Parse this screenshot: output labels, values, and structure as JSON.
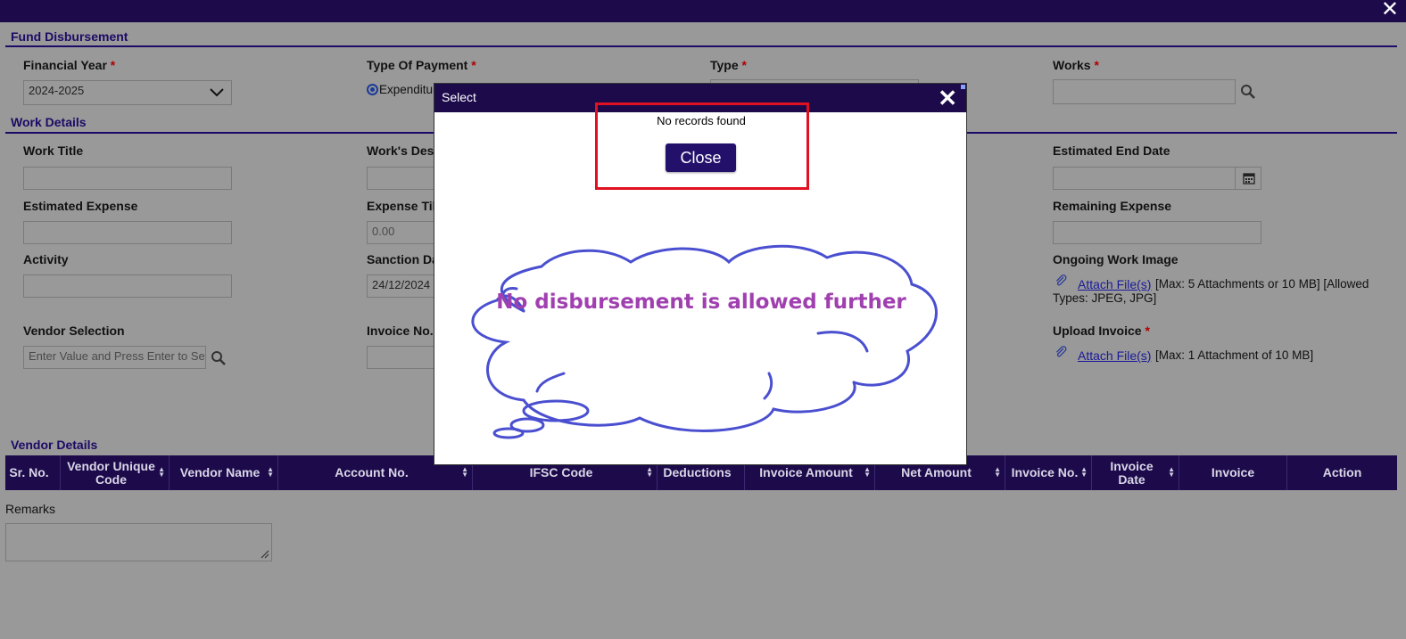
{
  "window": {
    "close_glyph": "✕"
  },
  "sections": {
    "fund_disbursement": "Fund Disbursement",
    "work_details": "Work Details",
    "vendor_details": "Vendor Details"
  },
  "form": {
    "financial_year": {
      "label": "Financial Year",
      "value": "2024-2025"
    },
    "type_of_payment": {
      "label": "Type Of Payment",
      "option": "Expenditure"
    },
    "type": {
      "label": "Type"
    },
    "works": {
      "label": "Works",
      "value": ""
    },
    "work_title": {
      "label": "Work Title",
      "value": ""
    },
    "works_description": {
      "label": "Work's Description"
    },
    "estimated_end_date": {
      "label": "Estimated End Date",
      "value": ""
    },
    "estimated_expense": {
      "label": "Estimated Expense",
      "value": ""
    },
    "expense_till_date": {
      "label": "Expense Till Date",
      "value": "0.00"
    },
    "remaining_expense": {
      "label": "Remaining Expense",
      "value": ""
    },
    "activity": {
      "label": "Activity",
      "value": ""
    },
    "sanction_date": {
      "label": "Sanction Date",
      "value": "24/12/2024"
    },
    "ongoing_work_image": {
      "label": "Ongoing Work Image",
      "link": "Attach File(s)",
      "note1": "[Max: 5 Attachments or 10 MB] [Allowed",
      "note2": "Types: JPEG, JPG]"
    },
    "vendor_selection": {
      "label": "Vendor Selection",
      "placeholder": "Enter Value and Press Enter to Search"
    },
    "invoice_no": {
      "label": "Invoice No."
    },
    "upload_invoice": {
      "label": "Upload Invoice",
      "link": "Attach File(s)",
      "note": "[Max: 1 Attachment of 10 MB]"
    },
    "required_mark": "*"
  },
  "table": {
    "columns": [
      {
        "label": "Sr. No.",
        "sortable": false
      },
      {
        "label": "Vendor Unique Code",
        "sortable": true
      },
      {
        "label": "Vendor Name",
        "sortable": true
      },
      {
        "label": "Account No.",
        "sortable": true
      },
      {
        "label": "IFSC Code",
        "sortable": true
      },
      {
        "label": "Deductions",
        "sortable": false
      },
      {
        "label": "Invoice Amount",
        "sortable": true
      },
      {
        "label": "Net Amount",
        "sortable": true
      },
      {
        "label": "Invoice No.",
        "sortable": true
      },
      {
        "label": "Invoice Date",
        "sortable": true
      },
      {
        "label": "Invoice",
        "sortable": false
      },
      {
        "label": "Action",
        "sortable": false
      }
    ]
  },
  "remarks": {
    "label": "Remarks",
    "value": ""
  },
  "modal": {
    "title": "Select",
    "close_glyph": "✕",
    "message": "No records found",
    "close_button": "Close",
    "annotation": "No disbursement is allowed further"
  },
  "colors": {
    "header_bg": "#1c0a4b",
    "overlay_bg": "#999999",
    "highlight_red": "#e01020",
    "annotation_text": "#a040b0",
    "cloud_stroke": "#4a4fd0"
  },
  "icons": [
    "close-icon",
    "chevron-down-icon",
    "search-icon",
    "calendar-icon",
    "paperclip-icon",
    "sort-icon",
    "resize-grip-icon"
  ]
}
